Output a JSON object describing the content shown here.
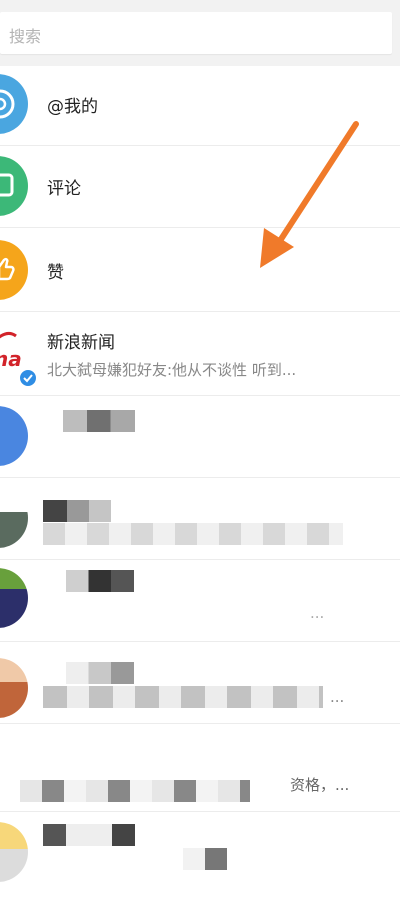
{
  "search": {
    "placeholder": "搜索"
  },
  "rows": [
    {
      "label": "@我的",
      "icon": "at-icon",
      "color": "#4aa6e0"
    },
    {
      "label": "评论",
      "icon": "comment-icon",
      "color": "#3cb878"
    },
    {
      "label": "赞",
      "icon": "thumbs-up-icon",
      "color": "#f5a51b"
    },
    {
      "label": "新浪新闻",
      "preview": "北大弑母嫌犯好友:他从不谈性 听到...",
      "icon": "sina-logo"
    }
  ],
  "blurred_rows": [
    {
      "snippet": ""
    },
    {
      "snippet": ""
    },
    {
      "snippet": "..."
    },
    {
      "snippet": "..."
    },
    {
      "snippet": "资格，..."
    },
    {
      "snippet": ""
    }
  ],
  "colors": {
    "arrow": "#f07a2a",
    "verified_badge": "#2f8de4"
  }
}
